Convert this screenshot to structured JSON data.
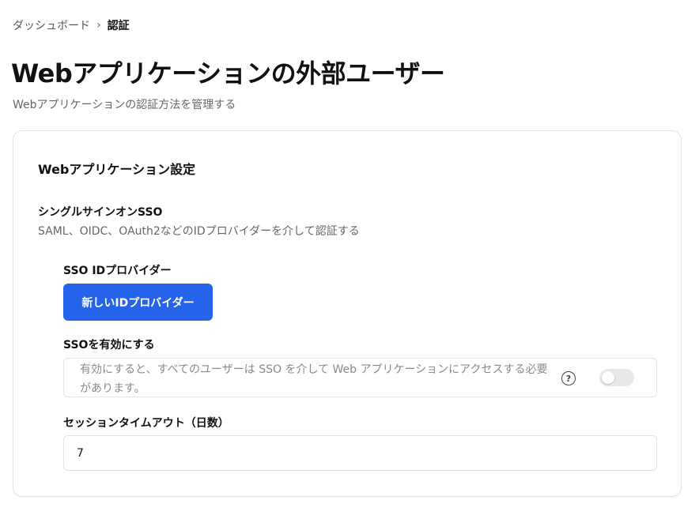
{
  "breadcrumb": {
    "parent": "ダッシュボード",
    "separator": "›",
    "current": "認証"
  },
  "header": {
    "title": "Webアプリケーションの外部ユーザー",
    "subtitle": "Webアプリケーションの認証方法を管理する"
  },
  "settings_card": {
    "title": "Webアプリケーション設定",
    "sso": {
      "title": "シングルサインオンSSO",
      "description": "SAML、OIDC、OAuth2などのIDプロバイダーを介して認証する",
      "idp_label": "SSO IDプロバイダー",
      "idp_button_label": "新しいIDプロバイダー",
      "enable_label": "SSOを有効にする",
      "enable_description": "有効にすると、すべてのユーザーは SSO を介して Web アプリケーションにアクセスする必要があります。",
      "enable_help_icon": "question-circle-icon",
      "enable_help_glyph": "?",
      "enabled": false
    },
    "session_timeout": {
      "label": "セッションタイムアウト（日数）",
      "value": "7"
    }
  },
  "colors": {
    "accent": "#2563eb",
    "toggle_off": "#e8e8e8"
  }
}
